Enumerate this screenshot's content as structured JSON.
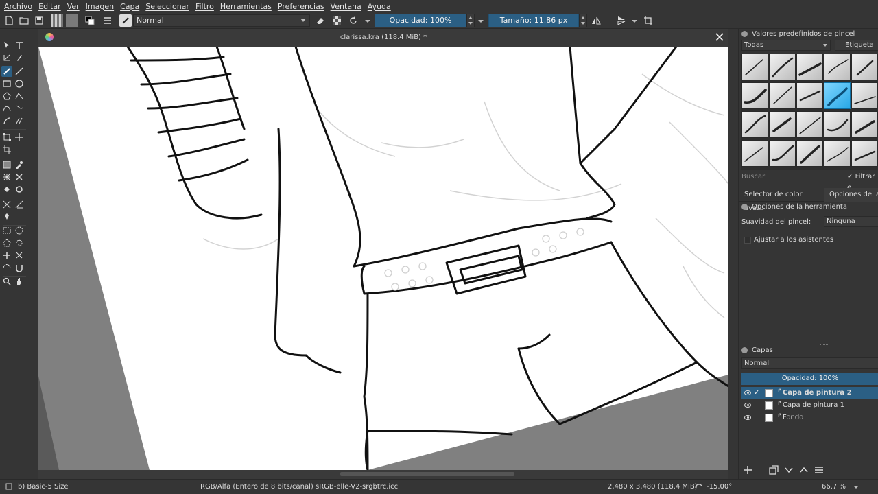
{
  "menu": [
    "Archivo",
    "Editar",
    "Ver",
    "Imagen",
    "Capa",
    "Seleccionar",
    "Filtro",
    "Herramientas",
    "Preferencias",
    "Ventana",
    "Ayuda"
  ],
  "toolbar": {
    "blend_mode": "Normal",
    "opacity_label": "Opacidad: 100%",
    "size_label": "Tamaño: 11.86 px"
  },
  "document": {
    "title": "clarissa.kra (118.4 MiB) *"
  },
  "presets": {
    "title": "Valores predefinidos de pincel",
    "filter_value": "Todas",
    "tag_label": "Etiqueta",
    "search_placeholder": "Buscar",
    "filter_checkbox_label": "Filtrar e"
  },
  "tool_tabs": {
    "tab1": "Selector de color ava...",
    "tab2": "Opciones de la he"
  },
  "tool_options": {
    "title": "Opciones de la herramienta",
    "smoothing_label": "Suavidad del pincel:",
    "smoothing_value": "Ninguna",
    "snap_label": "Ajustar a los asistentes"
  },
  "layers": {
    "title": "Capas",
    "blend_mode": "Normal",
    "opacity_label": "Opacidad:  100%",
    "items": [
      {
        "name": "Capa de pintura 2",
        "selected": true
      },
      {
        "name": "Capa de pintura 1",
        "selected": false
      },
      {
        "name": "Fondo",
        "selected": false
      }
    ]
  },
  "status": {
    "brush": "b) Basic-5 Size",
    "color_space": "RGB/Alfa (Entero de 8 bits/canal)  sRGB-elle-V2-srgbtrc.icc",
    "dimensions": "2,480 x 3,480 (118.4 MiB)",
    "rotation": "-15.00°",
    "zoom": "66.7 %"
  },
  "colors": {
    "accent": "#2b5f84",
    "panel": "#353535",
    "canvas_bg": "#808080"
  }
}
